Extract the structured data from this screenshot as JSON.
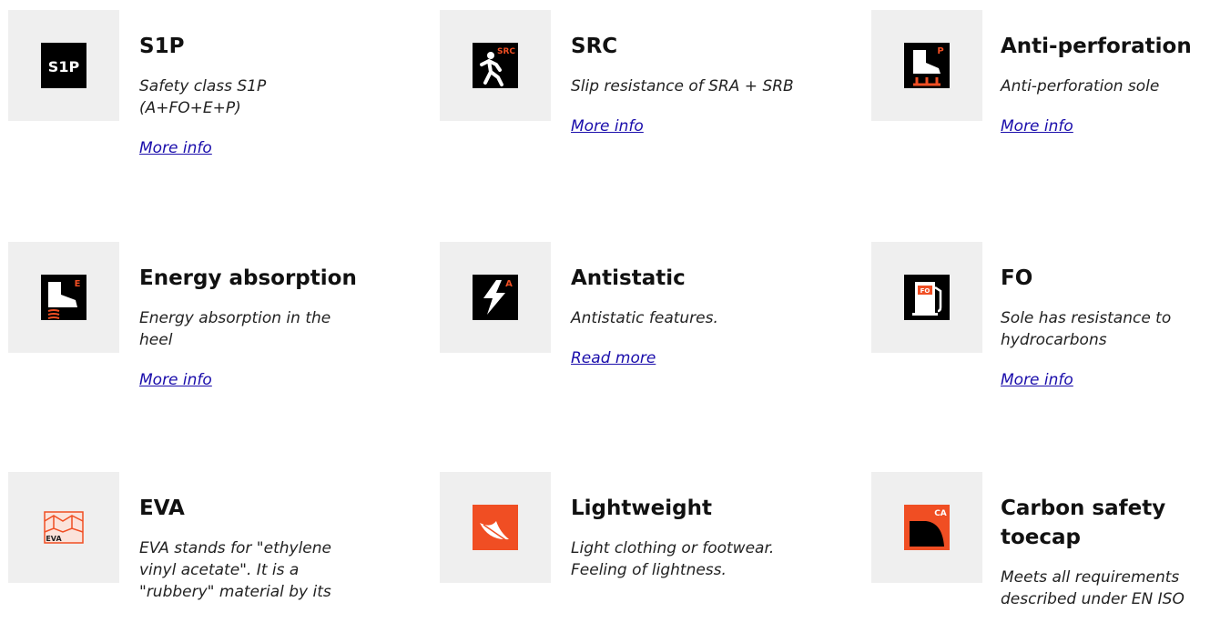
{
  "features": [
    {
      "title": "S1P",
      "desc": "Safety class S1P (A+FO+E+P)",
      "link": "More info",
      "icon": "s1p-icon"
    },
    {
      "title": "SRC",
      "desc": "Slip resistance of SRA + SRB",
      "link": "More info",
      "icon": "src-slip-icon"
    },
    {
      "title": "Anti-perforation",
      "desc": "Anti-perforation sole",
      "link": "More info",
      "icon": "anti-perforation-boot-icon"
    },
    {
      "title": "Energy absorption",
      "desc": "Energy absorption in the heel",
      "link": "More info",
      "icon": "energy-absorption-boot-icon"
    },
    {
      "title": "Antistatic",
      "desc": "Antistatic features.",
      "link": "Read more",
      "icon": "antistatic-bolt-icon"
    },
    {
      "title": "FO",
      "desc": "Sole has resistance to hydrocarbons",
      "link": "More info",
      "icon": "fuel-pump-icon"
    },
    {
      "title": "EVA",
      "desc": "EVA stands for \"ethylene vinyl acetate\". It is a \"rubbery\" material by its",
      "link": "",
      "icon": "eva-foam-icon"
    },
    {
      "title": "Lightweight",
      "desc": "Light clothing or footwear. Feeling of lightness.",
      "link": "",
      "icon": "feather-icon"
    },
    {
      "title": "Carbon safety toecap",
      "desc": "Meets all requirements described under EN ISO",
      "link": "",
      "icon": "carbon-toecap-icon"
    }
  ],
  "icon_labels": {
    "s1p": "S1P",
    "src": "SRC",
    "p": "P",
    "e": "E",
    "a": "A",
    "fo": "FO",
    "eva": "EVA",
    "ca": "CA"
  },
  "colors": {
    "accent": "#f04e23",
    "icon_bg": "#efefef",
    "link": "#1a0dab"
  }
}
